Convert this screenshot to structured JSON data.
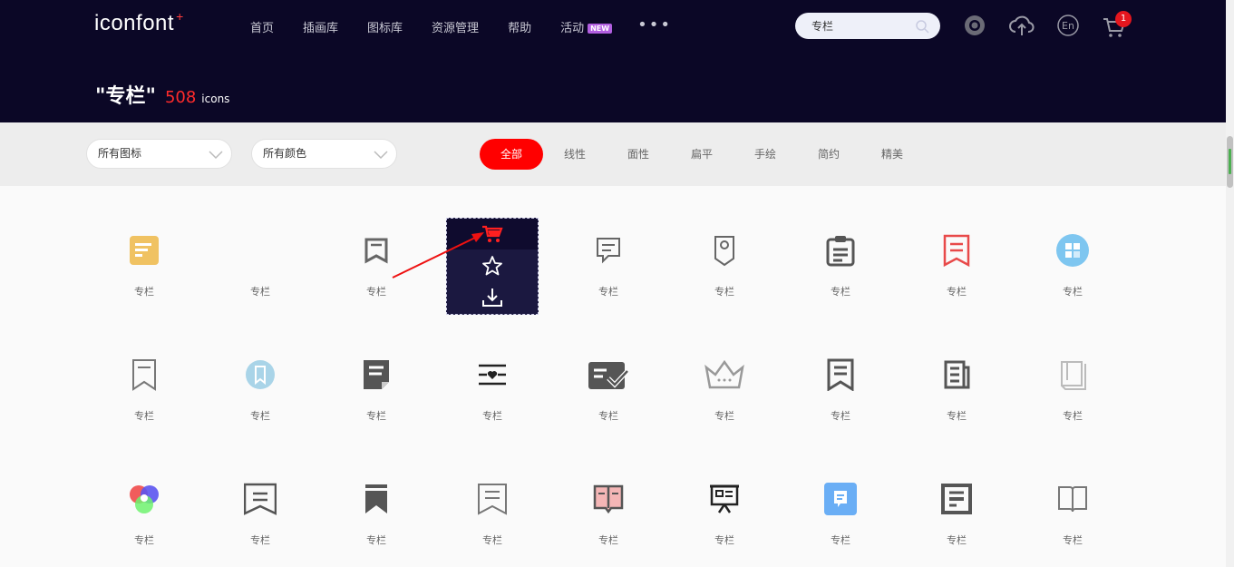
{
  "header": {
    "logo": "iconfont",
    "logo_plus": "+",
    "nav": [
      {
        "label": "首页"
      },
      {
        "label": "插画库"
      },
      {
        "label": "图标库"
      },
      {
        "label": "资源管理"
      },
      {
        "label": "帮助"
      },
      {
        "label": "活动",
        "badge": "NEW"
      }
    ],
    "more": "•••",
    "search_value": "专栏",
    "cart_count": "1",
    "title_query": "\"专栏\"",
    "title_count": "508",
    "title_unit": "icons"
  },
  "filters": {
    "dropdown_type": "所有图标",
    "dropdown_color": "所有颜色",
    "tabs": [
      "全部",
      "线性",
      "面性",
      "扁平",
      "手绘",
      "简约",
      "精美"
    ],
    "active_tab": "全部"
  },
  "grid": {
    "icons": [
      {
        "label": "专栏",
        "icon": "column-yellow-square-icon"
      },
      {
        "label": "专栏",
        "icon": "blank-icon"
      },
      {
        "label": "专栏",
        "icon": "bookmark-outline-icon"
      },
      {
        "label": "专栏",
        "icon": "hovered-icon"
      },
      {
        "label": "专栏",
        "icon": "document-outline-icon"
      },
      {
        "label": "专栏",
        "icon": "tag-outline-icon"
      },
      {
        "label": "专栏",
        "icon": "clipboard-icon"
      },
      {
        "label": "专栏",
        "icon": "red-bookmark-icon"
      },
      {
        "label": "专栏",
        "icon": "blue-circle-grid-icon"
      },
      {
        "label": "专栏",
        "icon": "bookmark-thin-icon"
      },
      {
        "label": "专栏",
        "icon": "blue-circle-bookmark-icon"
      },
      {
        "label": "专栏",
        "icon": "document-filled-icon"
      },
      {
        "label": "专栏",
        "icon": "heart-lines-icon"
      },
      {
        "label": "专栏",
        "icon": "card-check-icon"
      },
      {
        "label": "专栏",
        "icon": "crown-icon"
      },
      {
        "label": "专栏",
        "icon": "bookmark-bold-icon"
      },
      {
        "label": "专栏",
        "icon": "newspaper-icon"
      },
      {
        "label": "专栏",
        "icon": "book-gray-icon"
      },
      {
        "label": "专栏",
        "icon": "color-circles-icon"
      },
      {
        "label": "专栏",
        "icon": "bookmark-wide-icon"
      },
      {
        "label": "专栏",
        "icon": "bookmark-solid-icon"
      },
      {
        "label": "专栏",
        "icon": "bookmark-lines-icon"
      },
      {
        "label": "专栏",
        "icon": "pink-book-icon"
      },
      {
        "label": "专栏",
        "icon": "presentation-board-icon"
      },
      {
        "label": "专栏",
        "icon": "blue-square-doc-icon"
      },
      {
        "label": "专栏",
        "icon": "square-frame-icon"
      },
      {
        "label": "专栏",
        "icon": "open-book-icon"
      }
    ]
  },
  "overlay": {
    "icons": [
      "cart-icon",
      "star-icon",
      "download-icon"
    ]
  },
  "colors": {
    "header_bg": "#0b0726",
    "accent": "#ff0000"
  }
}
